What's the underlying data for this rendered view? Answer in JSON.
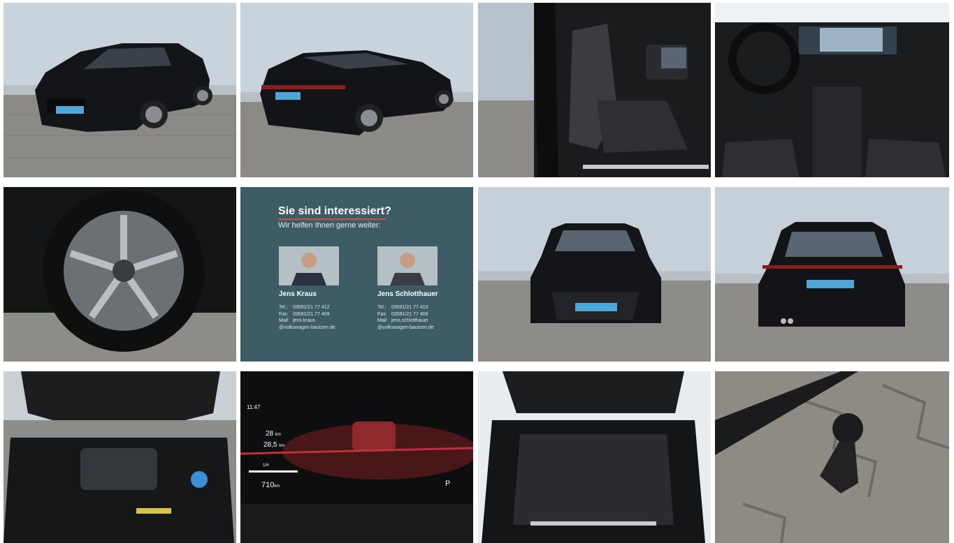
{
  "gallery": {
    "tiles": [
      {
        "name": "front-three-quarter-photo",
        "plate": ""
      },
      {
        "name": "rear-three-quarter-photo",
        "plate": ""
      },
      {
        "name": "driver-seat-photo"
      },
      {
        "name": "cockpit-photo"
      },
      {
        "name": "wheel-photo"
      },
      {
        "name": "contact-card"
      },
      {
        "name": "front-view-photo"
      },
      {
        "name": "rear-view-photo"
      },
      {
        "name": "engine-bay-photo"
      },
      {
        "name": "instrument-cluster-photo"
      },
      {
        "name": "trunk-photo"
      },
      {
        "name": "tow-hitch-photo"
      }
    ]
  },
  "contact": {
    "heading": "Sie sind interessiert?",
    "subheading": "Wir helfen Ihnen gerne weiter:",
    "people": [
      {
        "name": "Jens Kraus",
        "tel_label": "Tel.:",
        "tel": "03591/21 77 412",
        "fax_label": "Fax:",
        "fax": "03591/21 77 409",
        "mail_label": "Mail:",
        "mail": "jens.kraus",
        "mail_domain": "@volkswagen-bautzen.de"
      },
      {
        "name": "Jens Schlotthauer",
        "tel_label": "Tel.:",
        "tel": "03591/21 77 413",
        "fax_label": "Fax:",
        "fax": "03591/21 77 409",
        "mail_label": "Mail:",
        "mail": "jens.schlotthauer",
        "mail_domain": "@volkswagen-bautzen.de"
      }
    ],
    "accent_color": "#d94a3a",
    "background_color": "#3d5c66"
  },
  "cluster": {
    "time": "11:47",
    "trip1": "28",
    "trip1_unit": "km",
    "trip2": "28,5",
    "trip2_unit": "km",
    "range": "710",
    "range_unit": "km",
    "gear": "P",
    "fuel_fraction": "1/4"
  }
}
